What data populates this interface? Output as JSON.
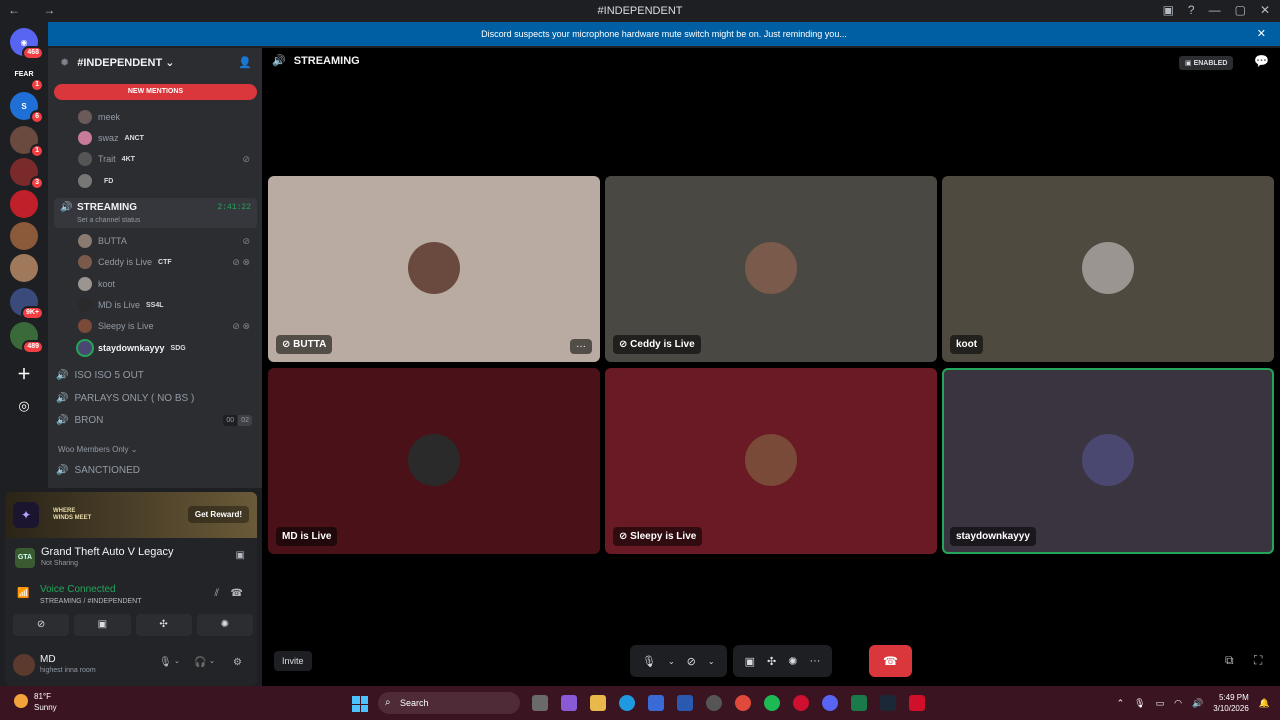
{
  "window": {
    "title": "#INDEPENDENT"
  },
  "servers": [
    {
      "label": "468",
      "top": 0
    },
    {
      "label": "1"
    },
    {
      "label": "6"
    },
    {
      "label": "1"
    },
    {
      "label": "3"
    },
    {
      "label": "9K+"
    },
    {
      "label": "489"
    }
  ],
  "banner": {
    "text": "Discord suspects your microphone hardware mute switch might be on. Just reminding you..."
  },
  "guild": {
    "name": "#INDEPENDENT ⌄",
    "new_mentions": "NEW MENTIONS"
  },
  "top_users": [
    {
      "name": "meek",
      "tag": ""
    },
    {
      "name": "swaz",
      "tag": "ANCT"
    },
    {
      "name": "Trait",
      "tag": "4KT"
    },
    {
      "name": "",
      "tag": "FD"
    }
  ],
  "streaming_channel": {
    "name": "STREAMING",
    "timer": "2:41:22",
    "status_hint": "Set a channel status",
    "users": [
      {
        "name": "BUTTA",
        "tag": ""
      },
      {
        "name": "Ceddy is Live",
        "tag": "CTF"
      },
      {
        "name": "koot",
        "tag": ""
      },
      {
        "name": "MD is Live",
        "tag": "SS4L"
      },
      {
        "name": "Sleepy is Live",
        "tag": ""
      },
      {
        "name": "staydownkayyy",
        "tag": "SDG"
      }
    ]
  },
  "other_channels": [
    {
      "name": "ISO ISO 5 OUT"
    },
    {
      "name": "PARLAYS ONLY ( NO BS )"
    },
    {
      "name": "BRON",
      "counts": [
        "00",
        "02"
      ]
    }
  ],
  "category": {
    "name": "Woo Members Only ⌄"
  },
  "category_channels": [
    {
      "name": "SANCTIONED"
    }
  ],
  "promo": {
    "text_line1": "WHERE",
    "text_line2": "WINDS MEET",
    "button": "Get Reward!"
  },
  "activity": {
    "game": "Grand Theft Auto V Legacy",
    "status": "Not Sharing",
    "icon_text": "GTA"
  },
  "voice": {
    "title": "Voice Connected",
    "location": "STREAMING / #INDEPENDENT"
  },
  "user": {
    "name": "MD",
    "status": "highest inna room"
  },
  "stage": {
    "channel_title": "STREAMING",
    "enabled_label": "ENABLED",
    "tiles": [
      {
        "name": "BUTTA",
        "bg": "#b9aba1",
        "av": "#6a4a3e",
        "more": "···"
      },
      {
        "name": "Ceddy is Live",
        "bg": "#4a4843",
        "av": "#7a5a4a"
      },
      {
        "name": "koot",
        "bg": "#4f4a40",
        "av": "#9a9590"
      },
      {
        "name": "MD is Live",
        "bg": "#4a1218",
        "av": "#2a2a2a"
      },
      {
        "name": "Sleepy is Live",
        "bg": "#6a1a24",
        "av": "#7a4a38"
      },
      {
        "name": "staydownkayyy",
        "bg": "#3a3340",
        "av": "#4a4870"
      }
    ],
    "invite": "Invite"
  },
  "taskbar": {
    "weather_temp": "81°F",
    "weather_desc": "Sunny",
    "search_placeholder": "Search",
    "time": "5:49 PM",
    "date": "3/10/2026"
  },
  "colors": {
    "accent_green": "#23a55a",
    "danger": "#da373c",
    "banner": "#005fa3"
  }
}
